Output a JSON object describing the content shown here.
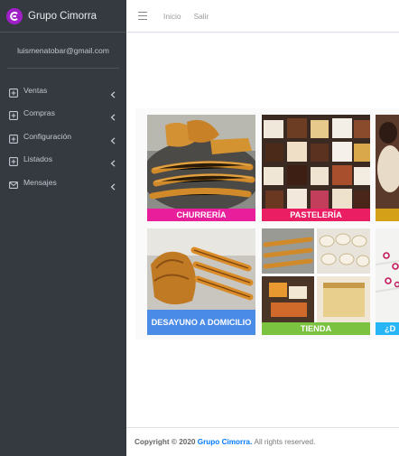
{
  "brand": {
    "name": "Grupo Cimorra",
    "logo_icon": "cimorra-logo-icon",
    "logo_color": "#a020c8"
  },
  "user": {
    "email": "luismenatobar@gmail.com"
  },
  "sidebar": {
    "items": [
      {
        "label": "Ventas",
        "icon": "plus-square-icon"
      },
      {
        "label": "Compras",
        "icon": "plus-square-icon"
      },
      {
        "label": "Configuración",
        "icon": "plus-square-icon"
      },
      {
        "label": "Listados",
        "icon": "plus-square-icon"
      },
      {
        "label": "Mensajes",
        "icon": "envelope-icon"
      }
    ]
  },
  "topbar": {
    "menu_icon": "hamburger-icon",
    "links": [
      "Inicio",
      "Salir"
    ]
  },
  "gallery": {
    "tiles": [
      {
        "caption": "CHURRERÍA",
        "color": "#e91e9a"
      },
      {
        "caption": "PASTELERÍA",
        "color": "#e91e63"
      },
      {
        "caption": "",
        "color": "#d4a017"
      },
      {
        "caption": "DESAYUNO A DOMICILIO",
        "color": "#4a8be8"
      },
      {
        "caption": "TIENDA",
        "color": "#7cc241"
      },
      {
        "caption": "¿D",
        "color": "#29b6f6"
      }
    ]
  },
  "footer": {
    "copyright": "Copyright © 2020",
    "company": "Grupo Cimorra.",
    "rights": "All rights reserved."
  }
}
